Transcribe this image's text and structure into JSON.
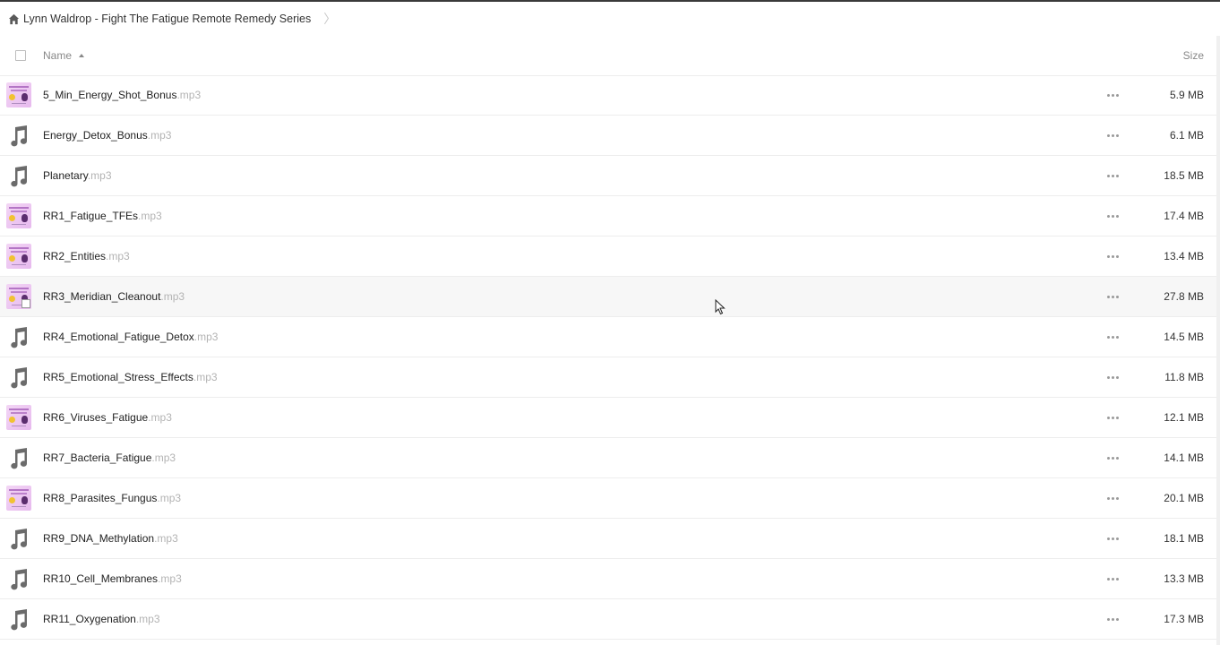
{
  "breadcrumb": {
    "folder": "Lynn Waldrop - Fight The Fatigue Remote Remedy Series"
  },
  "columns": {
    "name": "Name",
    "size": "Size"
  },
  "files": [
    {
      "base": "5_Min_Energy_Shot_Bonus",
      "ext": ".mp3",
      "size": "5.9 MB",
      "icon": "album-art-thumbnail"
    },
    {
      "base": "Energy_Detox_Bonus",
      "ext": ".mp3",
      "size": "6.1 MB",
      "icon": "music-note-icon"
    },
    {
      "base": "Planetary",
      "ext": ".mp3",
      "size": "18.5 MB",
      "icon": "music-note-icon"
    },
    {
      "base": "RR1_Fatigue_TFEs",
      "ext": ".mp3",
      "size": "17.4 MB",
      "icon": "album-art-thumbnail"
    },
    {
      "base": "RR2_Entities",
      "ext": ".mp3",
      "size": "13.4 MB",
      "icon": "album-art-thumbnail"
    },
    {
      "base": "RR3_Meridian_Cleanout",
      "ext": ".mp3",
      "size": "27.8 MB",
      "icon": "album-art-thumbnail",
      "hover": true
    },
    {
      "base": "RR4_Emotional_Fatigue_Detox",
      "ext": ".mp3",
      "size": "14.5 MB",
      "icon": "music-note-icon"
    },
    {
      "base": "RR5_Emotional_Stress_Effects",
      "ext": ".mp3",
      "size": "11.8 MB",
      "icon": "music-note-icon"
    },
    {
      "base": "RR6_Viruses_Fatigue",
      "ext": ".mp3",
      "size": "12.1 MB",
      "icon": "album-art-thumbnail"
    },
    {
      "base": "RR7_Bacteria_Fatigue",
      "ext": ".mp3",
      "size": "14.1 MB",
      "icon": "music-note-icon"
    },
    {
      "base": "RR8_Parasites_Fungus",
      "ext": ".mp3",
      "size": "20.1 MB",
      "icon": "album-art-thumbnail"
    },
    {
      "base": "RR9_DNA_Methylation",
      "ext": ".mp3",
      "size": "18.1 MB",
      "icon": "music-note-icon"
    },
    {
      "base": "RR10_Cell_Membranes",
      "ext": ".mp3",
      "size": "13.3 MB",
      "icon": "music-note-icon"
    },
    {
      "base": "RR11_Oxygenation",
      "ext": ".mp3",
      "size": "17.3 MB",
      "icon": "music-note-icon"
    }
  ]
}
